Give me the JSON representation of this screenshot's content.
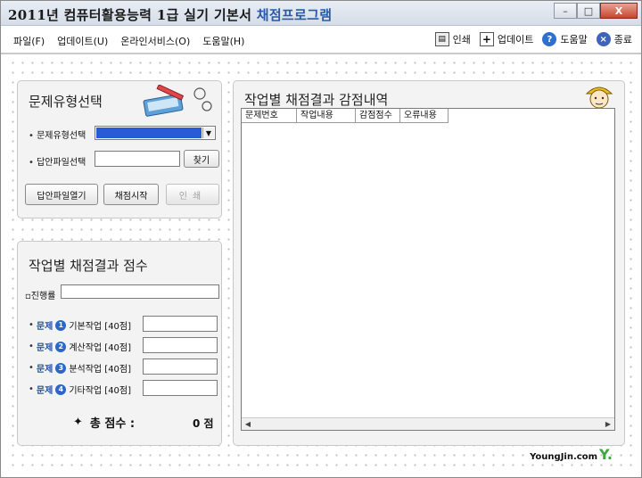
{
  "window": {
    "title_main": "2011년 컴퓨터활용능력 1급 실기 기본서",
    "title_accent": "채점프로그램",
    "minimize_glyph": "–",
    "maximize_glyph": "□",
    "close_glyph": "X"
  },
  "menu": {
    "items": [
      "파일(F)",
      "업데이트(U)",
      "온라인서비스(O)",
      "도움말(H)"
    ],
    "tools": {
      "print_label": "인쇄",
      "update_label": "업데이트",
      "help_label": "도움말",
      "exit_label": "종료"
    }
  },
  "left_top": {
    "title": "문제유형선택",
    "type_label": "문제유형선택",
    "answer_label": "답안파일선택",
    "find_button": "찾기",
    "open_button": "답안파일열기",
    "start_button": "채점시작",
    "print_button": "인쇄"
  },
  "left_bottom": {
    "title": "작업별 채점결과 점수",
    "progress_label": "진행률",
    "questions": [
      {
        "word": "문제",
        "num": "1",
        "name": "기본작업 [40점]"
      },
      {
        "word": "문제",
        "num": "2",
        "name": "계산작업 [40점]"
      },
      {
        "word": "문제",
        "num": "3",
        "name": "분석작업 [40점]"
      },
      {
        "word": "문제",
        "num": "4",
        "name": "기타작업 [40점]"
      }
    ],
    "total_label": "총 점수 :",
    "total_score": "0 점"
  },
  "right": {
    "title": "작업별 채점결과 감점내역",
    "columns": [
      "문제번호",
      "작업내용",
      "감점점수",
      "오류내용"
    ]
  },
  "brand": {
    "text": "YoungJin.com",
    "mark": "Y."
  },
  "colors": {
    "accent": "#2b5aa8",
    "select_highlight": "#2a5bd7",
    "question_word": "#1f4fa8"
  }
}
